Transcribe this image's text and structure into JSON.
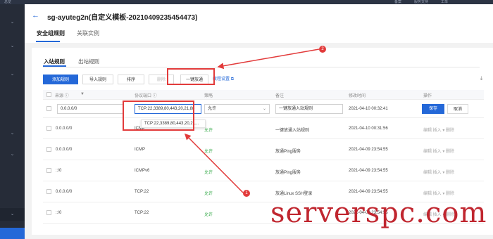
{
  "topbar": {
    "left_label": "总览",
    "right_items": [
      "备案",
      "服务支持",
      "工单"
    ]
  },
  "header": {
    "title": "sg-ayuteg2n(自定义模板-20210409235454473)",
    "tabs": [
      {
        "label": "安全组规则"
      },
      {
        "label": "关联实例"
      }
    ]
  },
  "rules_tabs": [
    {
      "label": "入站规则"
    },
    {
      "label": "出站规则"
    }
  ],
  "toolbar": {
    "add_label": "添加规则",
    "import_label": "导入规则",
    "sort_label": "排序",
    "delete_label": "删除",
    "open_all_label": "一键放通",
    "tutorial_label": "教程设置"
  },
  "table": {
    "headers": {
      "source": "来源",
      "port": "协议端口",
      "policy": "策略",
      "remark": "备注",
      "modified": "修改时间",
      "actions": "操作"
    },
    "edit_row": {
      "source": "0.0.0.0/0",
      "port": "TCP:22,3389,80,443,20,21,88",
      "policy": "允许",
      "remark": "一键放通入站规则",
      "modified": "2021-04-10 00:32:41",
      "save_label": "保存",
      "cancel_label": "取消"
    },
    "dropdown_suggestion": "TCP:22,3389,80,443,20,21...",
    "rows": [
      {
        "source": "0.0.0.0/0",
        "port": "ICMP",
        "policy": "允许",
        "remark": "一键放通入站规则",
        "modified": "2021-04-10 00:31:56",
        "actions": "编辑  插入 ▾  删除"
      },
      {
        "source": "0.0.0.0/0",
        "port": "ICMP",
        "policy": "允许",
        "remark": "放通Ping服务",
        "modified": "2021-04-09 23:54:55",
        "actions": "编辑  插入 ▾  删除"
      },
      {
        "source": "::/0",
        "port": "ICMPv6",
        "policy": "允许",
        "remark": "放通Ping服务",
        "modified": "2021-04-09 23:54:55",
        "actions": "编辑  插入 ▾  删除"
      },
      {
        "source": "0.0.0.0/0",
        "port": "TCP:22",
        "policy": "允许",
        "remark": "放通Linux SSH登录",
        "modified": "2021-04-09 23:54:55",
        "actions": "编辑  插入 ▾  删除"
      },
      {
        "source": "::/0",
        "port": "TCP:22",
        "policy": "允许",
        "remark": "",
        "modified": "2021-04-09 23:54:55",
        "actions": "编辑  插入 ▾  删除"
      }
    ]
  },
  "annotations": {
    "badge_1": "1",
    "badge_2": "2"
  },
  "watermark": "serverspc.com",
  "colors": {
    "accent": "#2468d8",
    "annotation": "#e23b3b",
    "allow": "#2da641",
    "sidebar": "#262c38"
  }
}
